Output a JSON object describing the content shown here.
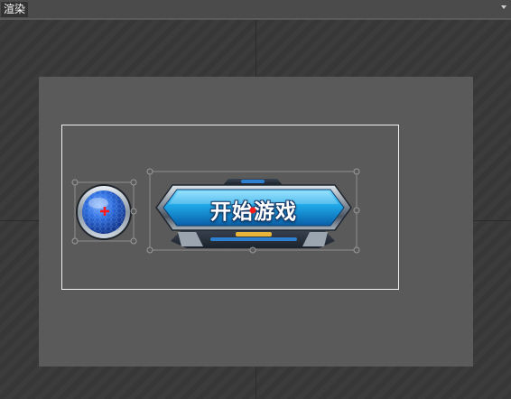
{
  "panel": {
    "tab_label": "渲染",
    "menu_icon": "dropdown-arrow-icon"
  },
  "scene": {
    "start_button": {
      "label": "开始游戏",
      "colors": {
        "face": "#1ea6e6",
        "frame": "#9aa5b0",
        "accent": "#e8b43a"
      }
    },
    "orb_button": {
      "icon": "blue-orb-icon",
      "colors": {
        "orb": "#2f6fe0",
        "ring": "#b8c2cc"
      }
    },
    "anchor_color": "#ff1a1a",
    "selection_color": "#8e8e8e"
  }
}
